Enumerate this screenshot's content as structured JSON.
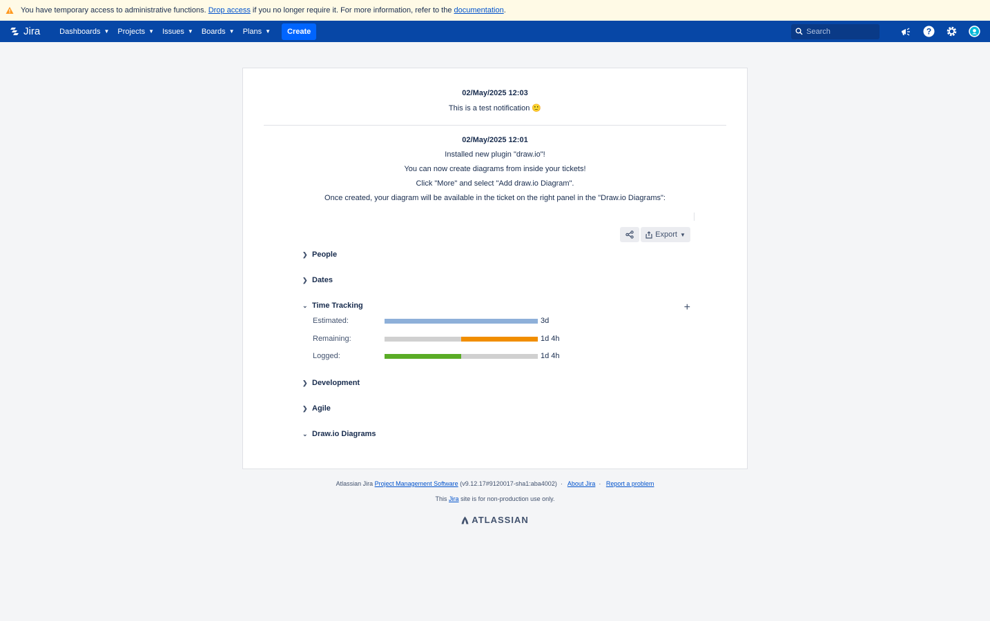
{
  "banner": {
    "text_before": "You have temporary access to administrative functions.",
    "drop_link": "Drop access",
    "text_mid": "if you no longer require it. For more information, refer to the",
    "doc_link": "documentation",
    "text_end": "."
  },
  "nav": {
    "logo": "Jira",
    "items": [
      "Dashboards",
      "Projects",
      "Issues",
      "Boards",
      "Plans"
    ],
    "create": "Create",
    "search_placeholder": "Search"
  },
  "notifications": [
    {
      "date": "02/May/2025 12:03",
      "lines": [
        "This is a test notification 🙂"
      ]
    },
    {
      "date": "02/May/2025 12:01",
      "lines": [
        "Installed new plugin \"draw.io\"!",
        "You can now create diagrams from inside your tickets!",
        "Click \"More\" and select \"Add draw.io Diagram\".",
        "Once created, your diagram will be available in the ticket on the right panel in the \"Draw.io Diagrams\":"
      ]
    }
  ],
  "toolbar": {
    "export": "Export"
  },
  "sections": {
    "people": "People",
    "dates": "Dates",
    "time_tracking": "Time Tracking",
    "development": "Development",
    "agile": "Agile",
    "drawio": "Draw.io Diagrams"
  },
  "time_tracking": {
    "estimated": {
      "label": "Estimated:",
      "value": "3d",
      "fill_fraction": 1.0,
      "color": "#8eb0d9"
    },
    "remaining": {
      "label": "Remaining:",
      "value": "1d 4h",
      "fill_fraction": 0.5,
      "color": "#f18e00"
    },
    "logged": {
      "label": "Logged:",
      "value": "1d 4h",
      "fill_fraction": 0.5,
      "color": "#5aac26"
    }
  },
  "footer": {
    "line1_a": "Atlassian Jira",
    "line1_link": "Project Management Software",
    "line1_version": "(v9.12.17#9120017-sha1:aba4002)",
    "about": "About Jira",
    "report": "Report a problem",
    "line2_a": "This",
    "line2_link": "Jira",
    "line2_b": "site is for non-production use only.",
    "brand": "ATLASSIAN"
  }
}
